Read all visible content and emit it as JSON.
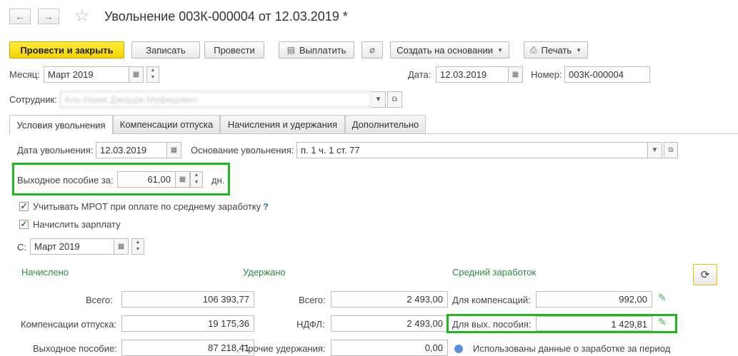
{
  "window": {
    "title": "Увольнение 003К-000004 от 12.03.2019 *",
    "back_icon": "←",
    "forward_icon": "→"
  },
  "toolbar": {
    "post_close": "Провести и закрыть",
    "save": "Записать",
    "post": "Провести",
    "pay": "Выплатить",
    "create_based": "Создать на основании",
    "print": "Печать"
  },
  "header": {
    "month_label": "Месяц:",
    "month_value": "Март 2019",
    "date_label": "Дата:",
    "date_value": "12.03.2019",
    "number_label": "Номер:",
    "number_value": "003К-000004",
    "employee_label": "Сотрудник:",
    "employee_value": "Аль-Нами Джордж Муфидович"
  },
  "tabs": [
    {
      "label": "Условия увольнения"
    },
    {
      "label": "Компенсации отпуска"
    },
    {
      "label": "Начисления и удержания"
    },
    {
      "label": "Дополнительно"
    }
  ],
  "conditions": {
    "dismissal_date_label": "Дата увольнения:",
    "dismissal_date_value": "12.03.2019",
    "reason_label": "Основание увольнения:",
    "reason_value": "п. 1 ч. 1 ст. 77",
    "severance_label": "Выходное пособие за:",
    "severance_value": "61,00",
    "severance_unit": "дн.",
    "mrot_label": "Учитывать МРОТ при оплате по среднему заработку",
    "mrot_help": "?",
    "accrue_salary_label": "Начислить зарплату",
    "from_label": "С:",
    "from_value": "Март 2019"
  },
  "accrued": {
    "heading": "Начислено",
    "total_label": "Всего:",
    "total_value": "106 393,77",
    "vacation_label": "Компенсации отпуска:",
    "vacation_value": "19 175,36",
    "severance_label": "Выходное пособие:",
    "severance_value": "87 218,41"
  },
  "withheld": {
    "heading": "Удержано",
    "total_label": "Всего:",
    "total_value": "2 493,00",
    "ndfl_label": "НДФЛ:",
    "ndfl_value": "2 493,00",
    "other_label": "Прочие удержания:",
    "other_value": "0,00"
  },
  "average": {
    "heading": "Средний заработок",
    "comp_label": "Для компенсаций:",
    "comp_value": "992,00",
    "sev_label": "Для вых. пособия:",
    "sev_value": "1 429,81",
    "info_text": "Использованы данные о заработке за период"
  },
  "colors": {
    "highlight": "#1fb51f",
    "primary_button": "#f5d400",
    "section_heading": "#2b8a3e"
  }
}
